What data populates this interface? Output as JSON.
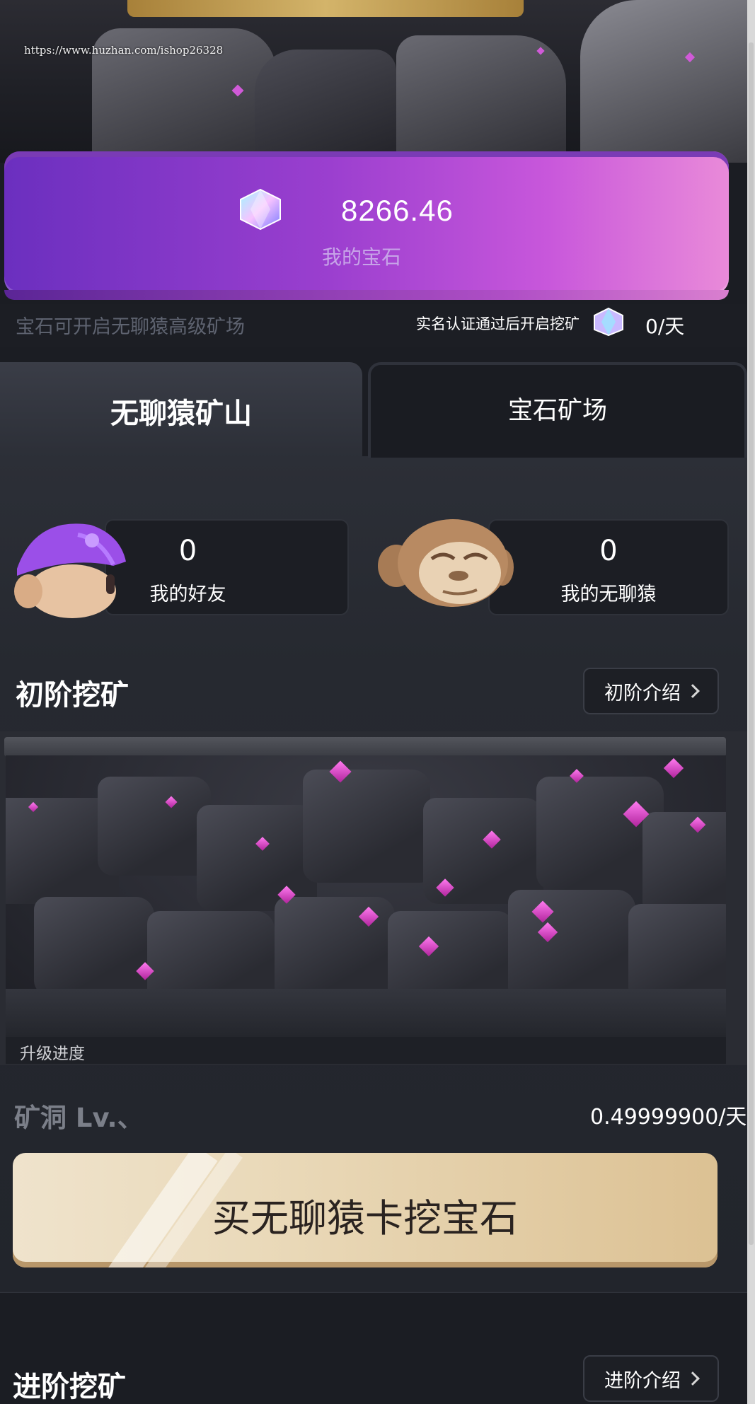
{
  "watermark": "https://www.huzhan.com/ishop26328",
  "gem_card": {
    "amount": "8266.46",
    "label": "我的宝石"
  },
  "info_bar": {
    "left_text": "宝石可开启无聊猿高级矿场",
    "right_text": "实名认证通过后开启挖矿",
    "per_day": "0/天"
  },
  "tabs": [
    {
      "label": "无聊猿矿山",
      "active": true
    },
    {
      "label": "宝石矿场",
      "active": false
    }
  ],
  "stats": {
    "friends": {
      "count": "0",
      "label": "我的好友"
    },
    "apes": {
      "count": "0",
      "label": "我的无聊猿"
    }
  },
  "section_basic": {
    "title": "初阶挖矿",
    "intro_button": "初阶介绍"
  },
  "mine": {
    "progress_label": "升级进度",
    "level_text": "矿洞 Lv.、",
    "rate": "0.49999900/天"
  },
  "buy_button": "买无聊猿卡挖宝石",
  "section_advanced": {
    "title": "进阶挖矿",
    "intro_button": "进阶介绍"
  },
  "colors": {
    "background": "#1b1d23",
    "gem_card_start": "#6b2fbf",
    "gem_card_end": "#e98ad9",
    "buy_button": "#e9d8b7",
    "crystal": "#e04fd4"
  }
}
